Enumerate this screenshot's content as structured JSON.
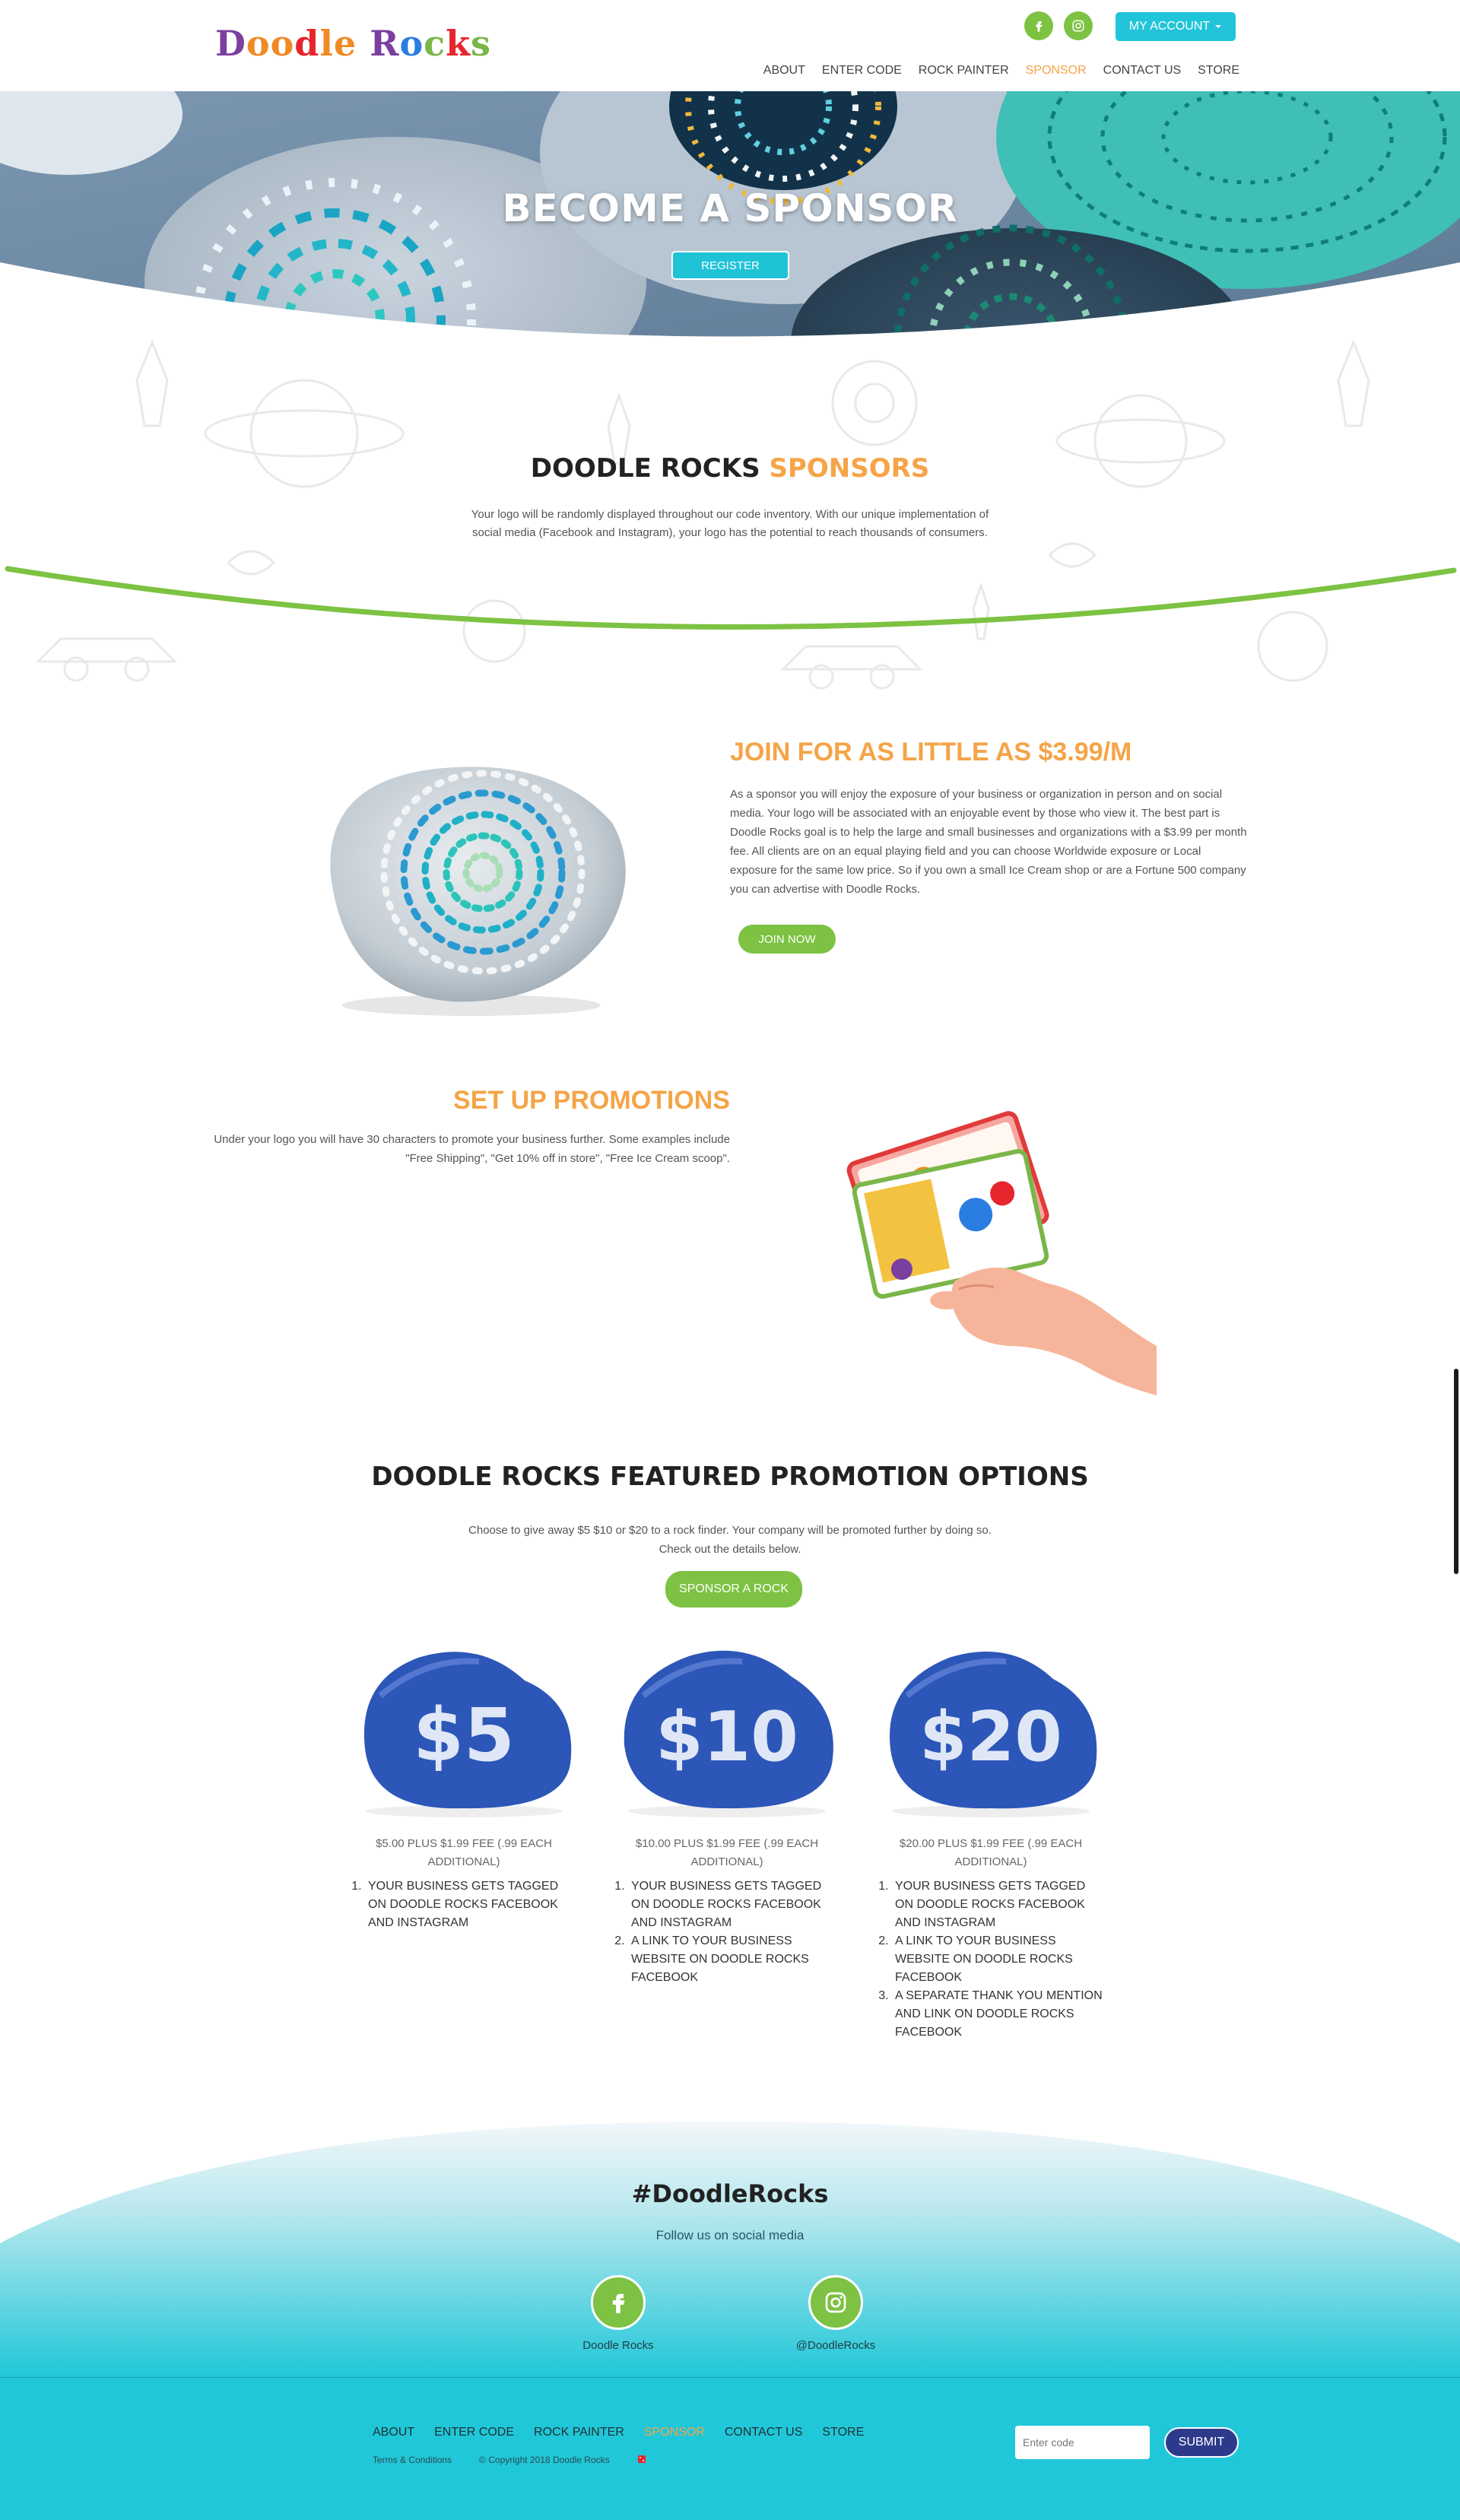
{
  "header": {
    "logo": [
      "D",
      "oo",
      "d",
      "le",
      " ",
      "R",
      "o",
      "c",
      "k",
      "s"
    ],
    "account_label": "MY ACCOUNT",
    "nav": [
      "ABOUT",
      "ENTER CODE",
      "ROCK PAINTER",
      "SPONSOR",
      "CONTACT US",
      "STORE"
    ],
    "active_nav": "SPONSOR"
  },
  "hero": {
    "title": "BECOME A SPONSOR",
    "register_label": "REGISTER"
  },
  "sponsors": {
    "title_part1": "DOODLE ROCKS",
    "title_part2": "SPONSORS",
    "text": "Your logo will be randomly displayed throughout our code inventory. With our unique implementation of social media (Facebook and Instagram), your logo has the potential to reach thousands of consumers."
  },
  "join": {
    "title": "JOIN FOR AS LITTLE AS $3.99/M",
    "text": "As a sponsor you will enjoy the exposure of your business or organization in person and on social media. Your logo will be associated with an enjoyable event by those who view it. The best part is Doodle Rocks goal is to help the large and small businesses and organizations with a $3.99 per month fee. All clients are on an equal playing field and you can choose Worldwide exposure or Local exposure for the same low price. So if you own a small Ice Cream shop or are a Fortune 500 company you can advertise with Doodle Rocks.",
    "button": "JOIN NOW"
  },
  "promotions": {
    "title": "SET UP PROMOTIONS",
    "text": "Under your logo you will have 30 characters to promote your business further. Some examples include \"Free Shipping\", \"Get 10% off in store\", \"Free Ice Cream scoop\"."
  },
  "featured": {
    "title": "DOODLE ROCKS FEATURED PROMOTION OPTIONS",
    "text": "Choose to give away $5 $10 or $20 to a rock finder. Your company will be promoted further by doing so. Check out the details below.",
    "button": "SPONSOR A ROCK",
    "options": [
      {
        "rock_label": "$5",
        "price": "$5.00 PLUS $1.99 FEE (.99 EACH ADDITIONAL)",
        "items": [
          "YOUR BUSINESS GETS TAGGED ON DOODLE ROCKS FACEBOOK AND INSTAGRAM"
        ]
      },
      {
        "rock_label": "$10",
        "price": "$10.00 PLUS $1.99 FEE (.99 EACH ADDITIONAL)",
        "items": [
          "YOUR BUSINESS GETS TAGGED ON DOODLE ROCKS FACEBOOK AND INSTAGRAM",
          "A LINK TO YOUR BUSINESS WEBSITE ON DOODLE ROCKS FACEBOOK"
        ]
      },
      {
        "rock_label": "$20",
        "price": "$20.00 PLUS $1.99 FEE (.99 EACH ADDITIONAL)",
        "items": [
          "YOUR BUSINESS GETS TAGGED ON DOODLE ROCKS FACEBOOK AND INSTAGRAM",
          "A LINK TO YOUR BUSINESS WEBSITE ON DOODLE ROCKS FACEBOOK",
          "A SEPARATE THANK YOU MENTION AND LINK ON DOODLE ROCKS FACEBOOK"
        ]
      }
    ]
  },
  "social": {
    "hashtag": "#DoodleRocks",
    "follow": "Follow us on social media",
    "facebook_caption": "Doodle Rocks",
    "instagram_caption": "@DoodleRocks"
  },
  "footer": {
    "nav": [
      "ABOUT",
      "ENTER CODE",
      "ROCK PAINTER",
      "SPONSOR",
      "CONTACT US",
      "STORE"
    ],
    "terms": "Terms & Conditions",
    "copyright": "© Copyright 2018 Doodle Rocks",
    "code_placeholder": "Enter code",
    "submit": "SUBMIT"
  },
  "colors": {
    "accent_orange": "#f5a447",
    "brand_green": "#7dc242",
    "brand_cyan": "#20c7d8",
    "submit_navy": "#2d3a8c"
  },
  "icons": [
    "facebook-icon",
    "instagram-icon",
    "chevron-down-icon",
    "dice-icon"
  ]
}
